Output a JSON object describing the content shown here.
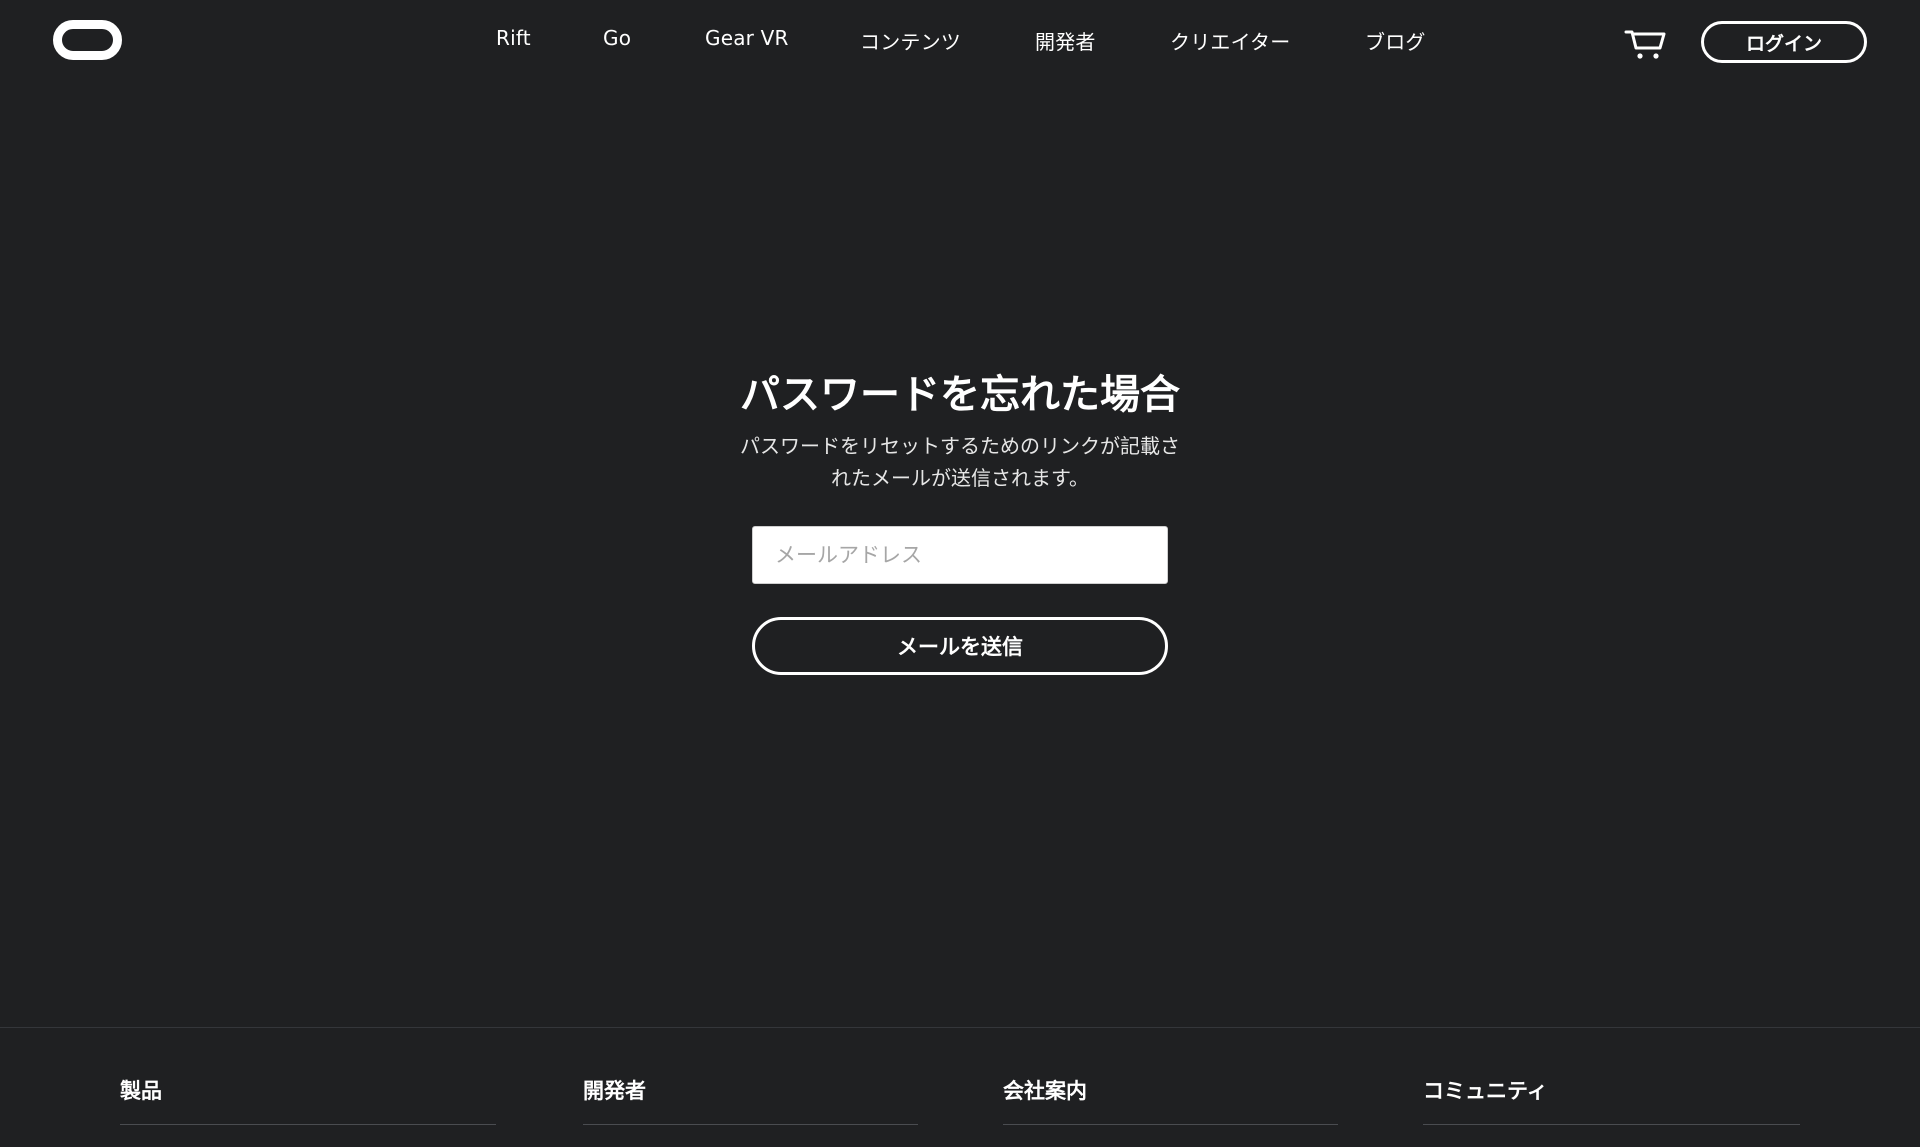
{
  "header": {
    "logo": "oculus-logo",
    "nav": [
      {
        "label": "Rift"
      },
      {
        "label": "Go"
      },
      {
        "label": "Gear VR"
      },
      {
        "label": "コンテンツ"
      },
      {
        "label": "開発者"
      },
      {
        "label": "クリエイター"
      },
      {
        "label": "ブログ"
      }
    ],
    "cart_icon": "cart-icon",
    "login_label": "ログイン"
  },
  "main": {
    "title": "パスワードを忘れた場合",
    "description_line1": "パスワードをリセットするためのリンクが記載さ",
    "description_line2": "れたメールが送信されます。",
    "email_placeholder": "メールアドレス",
    "email_value": "",
    "submit_label": "メールを送信"
  },
  "footer": {
    "columns": [
      {
        "heading": "製品"
      },
      {
        "heading": "開発者"
      },
      {
        "heading": "会社案内"
      },
      {
        "heading": "コミュニティ"
      }
    ]
  },
  "colors": {
    "background": "#1f2022",
    "text": "#ffffff",
    "input_bg": "#ffffff"
  }
}
